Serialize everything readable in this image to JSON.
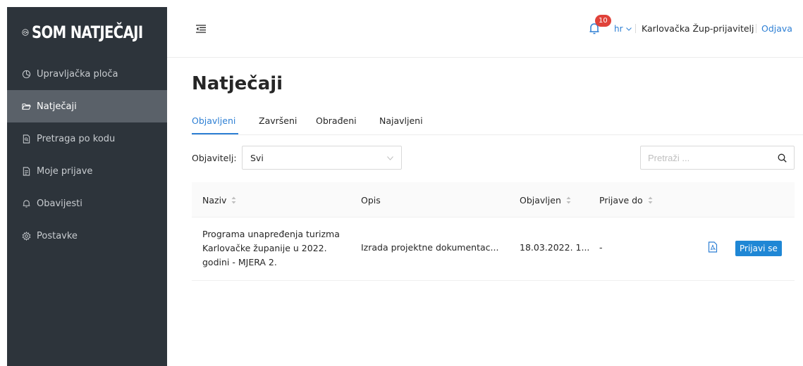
{
  "brand": {
    "name": "SOM NATJEČAJI"
  },
  "sidebar": {
    "items": [
      {
        "label": "Upravljačka ploča",
        "icon": "dashboard-icon",
        "active": false
      },
      {
        "label": "Natječaji",
        "icon": "folder-open-icon",
        "active": true
      },
      {
        "label": "Pretraga po kodu",
        "icon": "file-search-icon",
        "active": false
      },
      {
        "label": "Moje prijave",
        "icon": "file-text-icon",
        "active": false
      },
      {
        "label": "Obavijesti",
        "icon": "bell-icon",
        "active": false
      },
      {
        "label": "Postavke",
        "icon": "gear-icon",
        "active": false
      }
    ]
  },
  "header": {
    "notifications_count": "10",
    "language": "hr",
    "user": "Karlovačka Žup-prijavitelj",
    "logout": "Odjava"
  },
  "main": {
    "title": "Natječaji",
    "tabs": [
      {
        "label": "Objavljeni",
        "active": true
      },
      {
        "label": "Završeni",
        "active": false
      },
      {
        "label": "Obrađeni",
        "active": false
      },
      {
        "label": "Najavljeni",
        "active": false
      }
    ],
    "filter": {
      "label": "Objavitelj:",
      "value": "Svi"
    },
    "search": {
      "placeholder": "Pretraži ..."
    },
    "table": {
      "columns": [
        "Naziv",
        "Opis",
        "Objavljen",
        "Prijave do"
      ],
      "rows": [
        {
          "name": "Programa unapređenja turizma Karlovačke županije u 2022. godini - MJERA 2.",
          "description": "Izrada projektne dokumentac...",
          "published": "18.03.2022. 1...",
          "deadline": "-",
          "action": "Prijavi se"
        }
      ]
    }
  },
  "colors": {
    "accent": "#2d7fd4",
    "sidebar_bg": "#2d343b",
    "sidebar_active": "#5a6169",
    "badge": "#e0423a",
    "button": "#1f87d5"
  }
}
